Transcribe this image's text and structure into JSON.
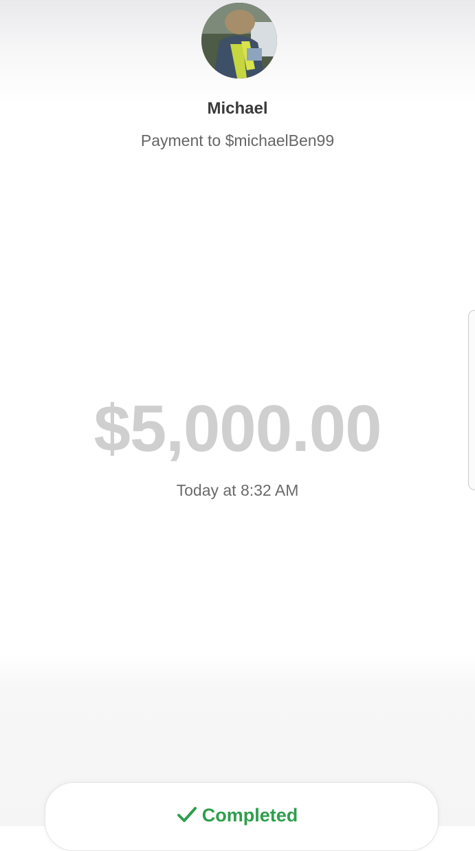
{
  "recipient": {
    "name": "Michael",
    "subtitle": "Payment to $michaelBen99"
  },
  "payment": {
    "amount": "$5,000.00",
    "timestamp": "Today at 8:32 AM",
    "status": "Completed"
  },
  "icons": {
    "avatar": "profile-photo",
    "status": "checkmark-icon"
  },
  "colors": {
    "amount": "#cfcfcf",
    "status": "#2e9e4d"
  }
}
